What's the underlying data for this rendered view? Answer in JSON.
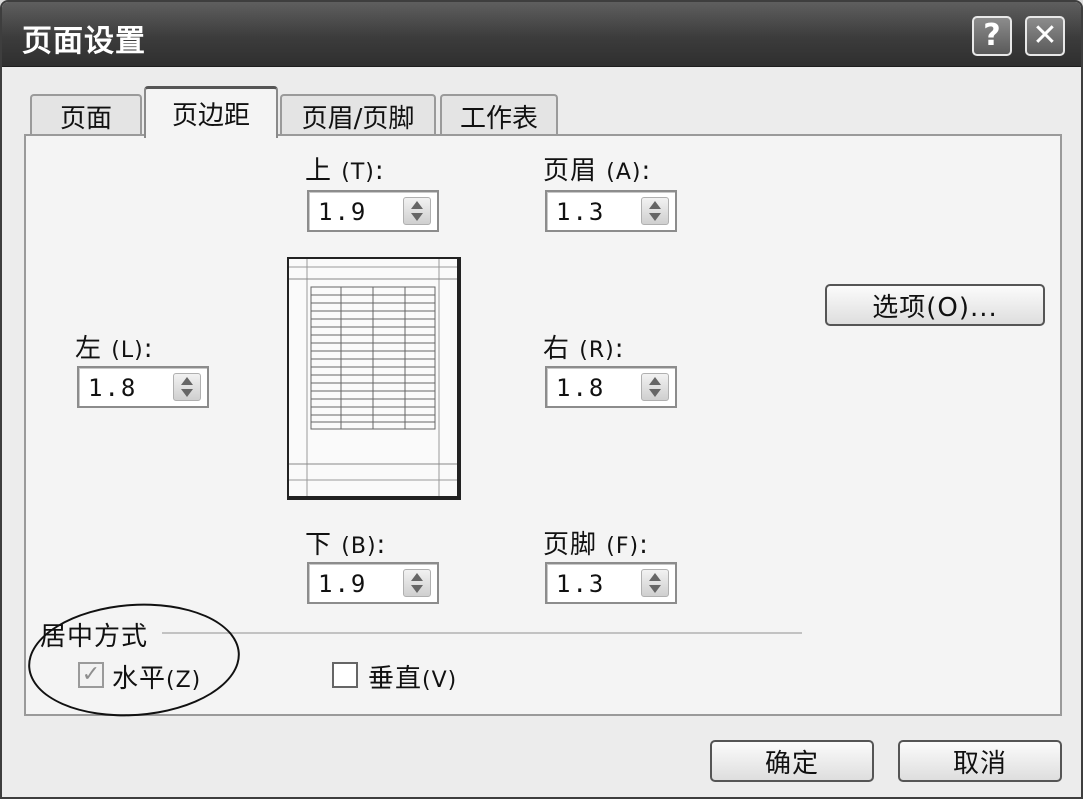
{
  "window": {
    "title": "页面设置",
    "help_glyph": "?",
    "close_glyph": "✕"
  },
  "tabs": [
    "页面",
    "页边距",
    "页眉/页脚",
    "工作表"
  ],
  "active_tab": "页边距",
  "margins": {
    "top": {
      "label": "上",
      "key": "(T)",
      "value": "1.9"
    },
    "header": {
      "label": "页眉",
      "key": "(A)",
      "value": "1.3"
    },
    "left": {
      "label": "左",
      "key": "(L)",
      "value": "1.8"
    },
    "right": {
      "label": "右",
      "key": "(R)",
      "value": "1.8"
    },
    "bottom": {
      "label": "下",
      "key": "(B)",
      "value": "1.9"
    },
    "footer": {
      "label": "页脚",
      "key": "(F)",
      "value": "1.3"
    }
  },
  "options_button": "选项(O)...",
  "center": {
    "group_label": "居中方式",
    "horizontal": {
      "label": "水平",
      "key": "(Z)",
      "checked": true
    },
    "vertical": {
      "label": "垂直",
      "key": "(V)",
      "checked": false
    }
  },
  "buttons": {
    "ok": "确定",
    "cancel": "取消"
  },
  "icons": {
    "help": "help-icon",
    "close": "close-icon",
    "spinner": "spinner-arrows-icon",
    "check": "checkmark-icon"
  },
  "colors": {
    "titlebar": "#3c3c3c",
    "dialog_bg": "#ececec",
    "panel_bg": "#f4f4f4"
  }
}
